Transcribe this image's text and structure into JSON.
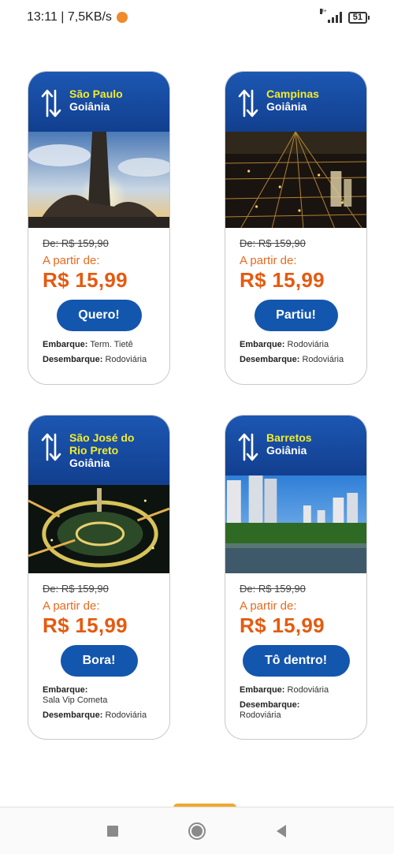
{
  "status_bar": {
    "time": "13:11 | 7,5KB/s",
    "network_type": "H+",
    "battery": "51"
  },
  "cards": [
    {
      "from": "São Paulo",
      "to": "Goiânia",
      "old_price": "De: R$ 159,90",
      "from_label": "A partir de:",
      "price": "R$ 15,99",
      "cta": "Quero!",
      "embarque_label": "Embarque:",
      "embarque_value": "Term. Tietê",
      "desembarque_label": "Desembarque:",
      "desembarque_value": "Rodoviária"
    },
    {
      "from": "Campinas",
      "to": "Goiânia",
      "old_price": "De: R$ 159,90",
      "from_label": "A partir de:",
      "price": "R$ 15,99",
      "cta": "Partiu!",
      "embarque_label": "Embarque:",
      "embarque_value": "Rodoviária",
      "desembarque_label": "Desembarque:",
      "desembarque_value": "Rodoviária"
    },
    {
      "from": "São José do Rio Preto",
      "to": "Goiânia",
      "old_price": "De: R$ 159,90",
      "from_label": "A partir de:",
      "price": "R$ 15,99",
      "cta": "Bora!",
      "embarque_label": "Embarque:",
      "embarque_value": "Sala Vip Cometa",
      "desembarque_label": "Desembarque:",
      "desembarque_value": "Rodoviária"
    },
    {
      "from": "Barretos",
      "to": "Goiânia",
      "old_price": "De: R$ 159,90",
      "from_label": "A partir de:",
      "price": "R$ 15,99",
      "cta": "Tô dentro!",
      "embarque_label": "Embarque:",
      "embarque_value": "Rodoviária",
      "desembarque_label": "Desembarque:",
      "desembarque_value": "Rodoviária"
    }
  ],
  "colors": {
    "header_blue": "#1c57b2",
    "origin_yellow": "#f3ec2b",
    "price_orange": "#e55a10",
    "button_blue": "#1356ae"
  },
  "nav_icons": [
    "recent-apps-icon",
    "home-icon",
    "back-icon"
  ]
}
